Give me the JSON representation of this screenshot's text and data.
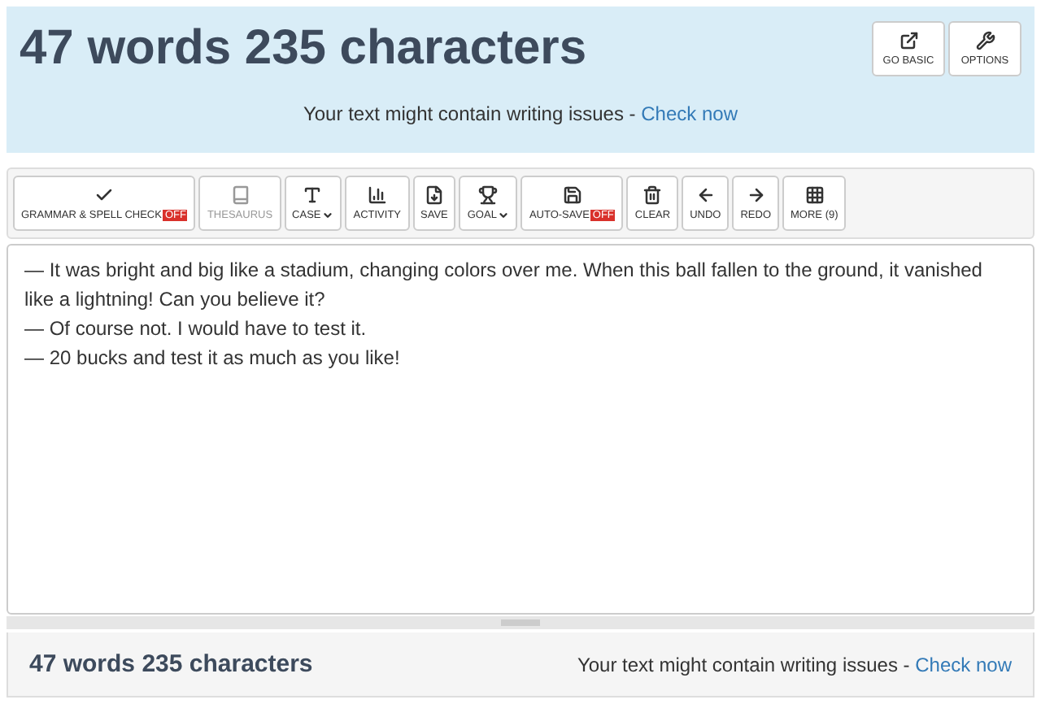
{
  "header": {
    "counter": "47 words 235 characters",
    "buttons": [
      {
        "label": "GO BASIC"
      },
      {
        "label": "OPTIONS"
      }
    ],
    "notice": "Your text might contain writing issues - ",
    "notice_link": "Check now"
  },
  "toolbar": [
    {
      "label": "GRAMMAR & SPELL CHECK",
      "badge": "OFF",
      "dropdown": false,
      "disabled": false
    },
    {
      "label": "THESAURUS",
      "dropdown": false,
      "disabled": true
    },
    {
      "label": "CASE",
      "dropdown": true,
      "disabled": false
    },
    {
      "label": "ACTIVITY",
      "dropdown": false,
      "disabled": false
    },
    {
      "label": "SAVE",
      "dropdown": false,
      "disabled": false
    },
    {
      "label": "GOAL",
      "dropdown": true,
      "disabled": false
    },
    {
      "label": "AUTO-SAVE",
      "badge": "OFF",
      "dropdown": false,
      "disabled": false
    },
    {
      "label": "CLEAR",
      "dropdown": false,
      "disabled": false
    },
    {
      "label": "UNDO",
      "dropdown": false,
      "disabled": false
    },
    {
      "label": "REDO",
      "dropdown": false,
      "disabled": false
    },
    {
      "label": "MORE (9)",
      "dropdown": false,
      "disabled": false
    }
  ],
  "editor": {
    "lines": [
      "— It was bright and big like a stadium, changing colors over me. When this ball fallen to the ground, it vanished like a lightning! Can you believe it?",
      "— Of course not. I would have to test it.",
      "— 20 bucks and test it as much as you like!"
    ]
  },
  "footer": {
    "counter": "47 words 235 characters",
    "notice": "Your text might contain writing issues - ",
    "notice_link": "Check now"
  }
}
